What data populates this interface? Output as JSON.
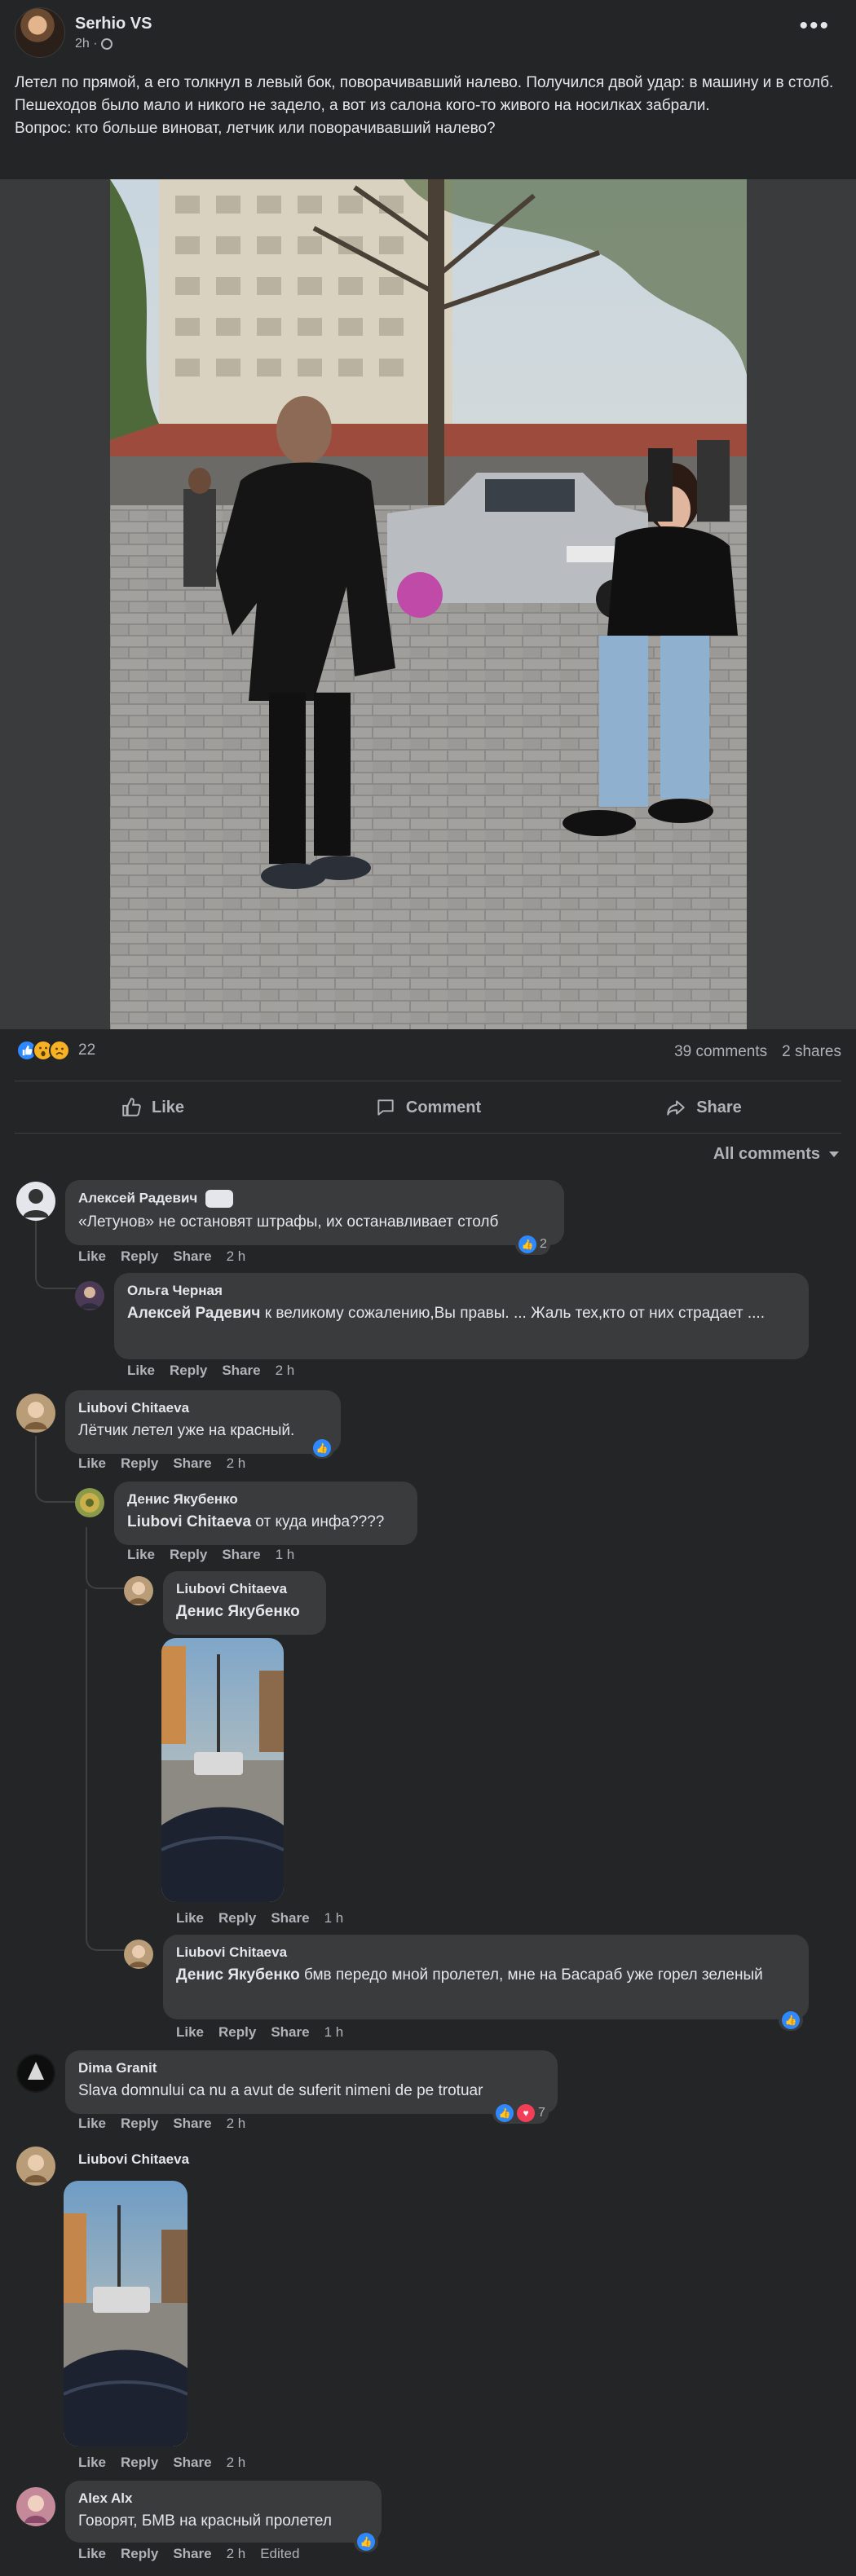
{
  "post": {
    "author": "Serhio VS",
    "time": "2h ·",
    "text": "Летел по прямой, а его толкнул в левый бок, поворачивавший налево. Получился двой удар: в машину и в столб. Пешеходов было мало и никого не задело, а вот из салона кого-то живого на носилках забрали.\nВопрос: кто больше виноват, летчик или поворачивавший налево?",
    "more_icon": "more-icon",
    "reaction_count": "22",
    "comments_count": "39 comments",
    "shares_count": "2 shares",
    "actions": {
      "like": "Like",
      "comment": "Comment",
      "share": "Share"
    },
    "sort_label": "All comments"
  },
  "colors": {
    "background": "#242526",
    "bubble": "#3a3b3c",
    "text": "#e4e6eb",
    "muted": "#b0b3b8",
    "accent": "#2e89ff"
  },
  "comments": [
    {
      "name": "Алексей Радевич",
      "text": "«Летунов» не остановят штрафы, их останавливает столб",
      "like": "Like",
      "reply": "Reply",
      "share": "Share",
      "time": "2 h",
      "reactions": "2"
    },
    {
      "name": "Ольга Черная",
      "mention": "Алексей Радевич",
      "text": " к великому сожалению,Вы правы. ... Жаль тех,кто от них страдает ....",
      "like": "Like",
      "reply": "Reply",
      "share": "Share",
      "time": "2 h"
    },
    {
      "name": "Liubovi Chitaeva",
      "text": "Лётчик летел уже на красный.",
      "like": "Like",
      "reply": "Reply",
      "share": "Share",
      "time": "2 h"
    },
    {
      "name": "Денис Якубенко",
      "mention": "Liubovi Chitaeva",
      "text": " от куда инфа????",
      "like": "Like",
      "reply": "Reply",
      "share": "Share",
      "time": "1 h"
    },
    {
      "name": "Liubovi Chitaeva",
      "mention": "Денис Якубенко",
      "text": "",
      "like": "Like",
      "reply": "Reply",
      "share": "Share",
      "time": "1 h"
    },
    {
      "name": "Liubovi Chitaeva",
      "mention": "Денис Якубенко",
      "text": " бмв передо мной пролетел, мне на Басараб уже горел зеленый",
      "like": "Like",
      "reply": "Reply",
      "share": "Share",
      "time": "1 h"
    },
    {
      "name": "Dima Granit",
      "text": "Slava domnului ca nu a avut de suferit nimeni de pe trotuar",
      "like": "Like",
      "reply": "Reply",
      "share": "Share",
      "time": "2 h",
      "reactions": "7"
    },
    {
      "name": "Liubovi Chitaeva",
      "like": "Like",
      "reply": "Reply",
      "share": "Share",
      "time": "2 h"
    },
    {
      "name": "Alex Alx",
      "text": "Говорят, БМВ на красный пролетел",
      "like": "Like",
      "reply": "Reply",
      "share": "Share",
      "time": "2 h",
      "edited": "Edited"
    }
  ]
}
